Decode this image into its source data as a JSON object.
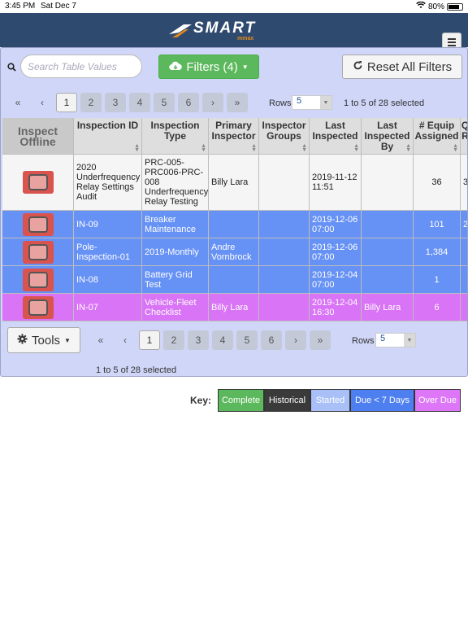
{
  "status_bar": {
    "time": "3:45 PM",
    "date": "Sat Dec 7",
    "battery": "80%",
    "battery_level": 0.8
  },
  "app": {
    "logo_text": "SMART",
    "logo_sub": "mmax"
  },
  "toolbar": {
    "search_placeholder": "Search Table Values",
    "filters_label": "Filters (4)",
    "reset_label": "Reset All Filters"
  },
  "pagination": {
    "first": "«",
    "prev": "‹",
    "next": "›",
    "last": "»",
    "pages": [
      "1",
      "2",
      "3",
      "4",
      "5",
      "6"
    ],
    "rows_label": "Rows",
    "rows_value": "5",
    "selected_text": "1 to 5 of 28 selected"
  },
  "table": {
    "headers": [
      "Inspect Offline",
      "Inspection ID",
      "Inspection Type",
      "Primary Inspector",
      "Inspector Groups",
      "Last Inspected",
      "Last Inspected By",
      "# Equip Assigned",
      "Q R"
    ],
    "rows": [
      {
        "id": "2020 Underfrequency Relay Settings Audit",
        "type": "PRC-005-PRC006-PRC-008 Underfrequency Relay Testing",
        "inspector": "Billy Lara",
        "groups": "",
        "last": "2019-11-12 11:51",
        "last_by": "",
        "equip": "36",
        "q": "3"
      },
      {
        "id": "IN-09",
        "type": "Breaker Maintenance",
        "inspector": "",
        "groups": "",
        "last": "2019-12-06 07:00",
        "last_by": "",
        "equip": "101",
        "q": "2"
      },
      {
        "id": "Pole-Inspection-01",
        "type": "2019-Monthly",
        "inspector": "Andre Vornbrock",
        "groups": "",
        "last": "2019-12-06 07:00",
        "last_by": "",
        "equip": "1,384",
        "q": ""
      },
      {
        "id": "IN-08",
        "type": "Battery Grid Test",
        "inspector": "",
        "groups": "",
        "last": "2019-12-04 07:00",
        "last_by": "",
        "equip": "1",
        "q": ""
      },
      {
        "id": "IN-07",
        "type": "Vehicle-Fleet Checklist",
        "inspector": "Billy Lara",
        "groups": "",
        "last": "2019-12-04 16:30",
        "last_by": "Billy Lara",
        "equip": "6",
        "q": ""
      }
    ]
  },
  "tools_label": "Tools",
  "key": {
    "label": "Key:",
    "items": [
      {
        "label": "Complete",
        "color": "#5cb85c",
        "text_color": "#ffffff"
      },
      {
        "label": "Historical",
        "color": "#3a3a3a",
        "text_color": "#ffffff"
      },
      {
        "label": "Started",
        "color": "#a8c0f7",
        "text_color": "#ffffff"
      },
      {
        "label": "Due < 7 Days",
        "color": "#4d7ff0",
        "text_color": "#ffffff"
      },
      {
        "label": "Over Due",
        "color": "#dd77f7",
        "text_color": "#ffffff"
      }
    ]
  },
  "colors": {
    "appbar": "#2e4a6f",
    "panel": "#cfd6f7",
    "row_due": "#6691f5",
    "row_overdue": "#d874f5"
  }
}
